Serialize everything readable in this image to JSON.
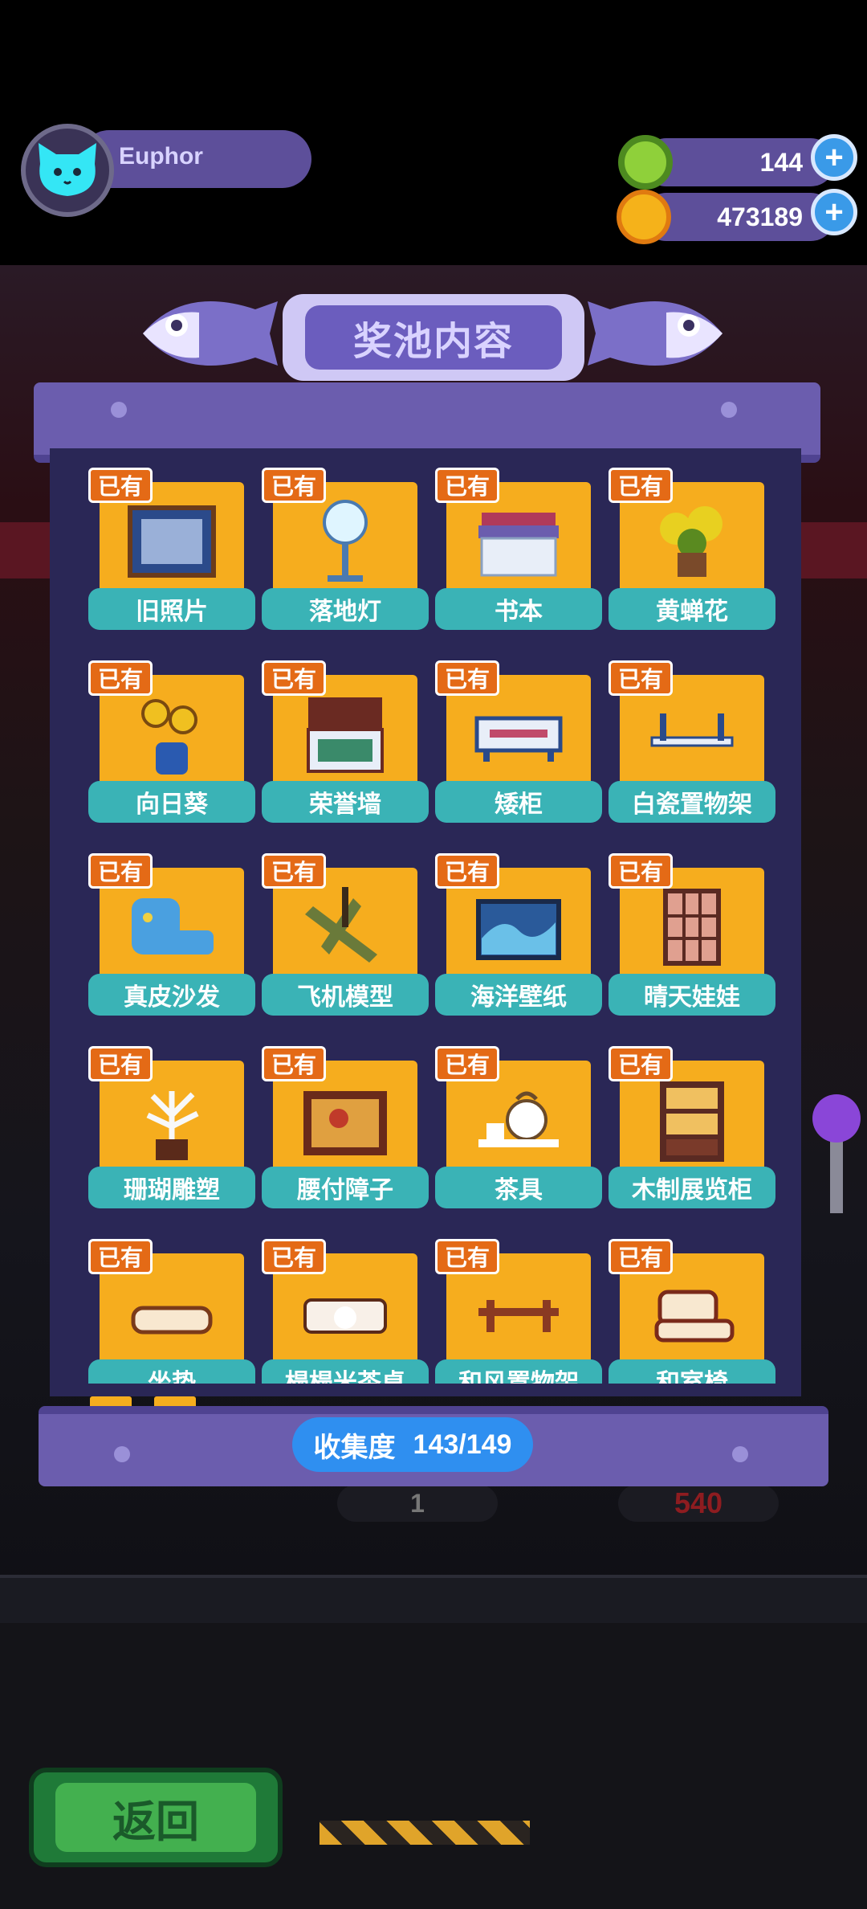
{
  "player": {
    "name": "Euphor"
  },
  "currency": {
    "gems": "144",
    "coins": "473189",
    "plus_symbol": "+"
  },
  "panel": {
    "title": "奖池内容",
    "collection_label": "收集度",
    "collection_value": "143/149"
  },
  "badge_text": "已有",
  "items": [
    {
      "name": "旧照片",
      "icon": "photo-frame-icon"
    },
    {
      "name": "落地灯",
      "icon": "floor-lamp-icon"
    },
    {
      "name": "书本",
      "icon": "books-icon"
    },
    {
      "name": "黄蝉花",
      "icon": "yellow-flower-icon"
    },
    {
      "name": "向日葵",
      "icon": "sunflower-icon"
    },
    {
      "name": "荣誉墙",
      "icon": "honor-wall-icon"
    },
    {
      "name": "矮柜",
      "icon": "low-cabinet-icon"
    },
    {
      "name": "白瓷置物架",
      "icon": "shelf-icon"
    },
    {
      "name": "真皮沙发",
      "icon": "sofa-icon"
    },
    {
      "name": "飞机模型",
      "icon": "airplane-model-icon"
    },
    {
      "name": "海洋壁纸",
      "icon": "ocean-wallpaper-icon"
    },
    {
      "name": "晴天娃娃",
      "icon": "window-screen-icon"
    },
    {
      "name": "珊瑚雕塑",
      "icon": "coral-sculpture-icon"
    },
    {
      "name": "腰付障子",
      "icon": "shoji-icon"
    },
    {
      "name": "茶具",
      "icon": "tea-set-icon"
    },
    {
      "name": "木制展览柜",
      "icon": "display-cabinet-icon"
    },
    {
      "name": "坐垫",
      "icon": "cushion-icon"
    },
    {
      "name": "榻榻米茶桌",
      "icon": "tea-table-icon"
    },
    {
      "name": "和风置物架",
      "icon": "japanese-shelf-icon"
    },
    {
      "name": "和室椅",
      "icon": "japanese-chair-icon"
    }
  ],
  "background": {
    "counter_value": "1",
    "cost_value": "540"
  },
  "back_button": "返回",
  "colors": {
    "panel": "#6b5dae",
    "panel_inner": "#2a2756",
    "card": "#f6ad1e",
    "card_label": "#3ab3b6",
    "badge": "#e46a16",
    "collect_pill": "#2f8ff0"
  }
}
